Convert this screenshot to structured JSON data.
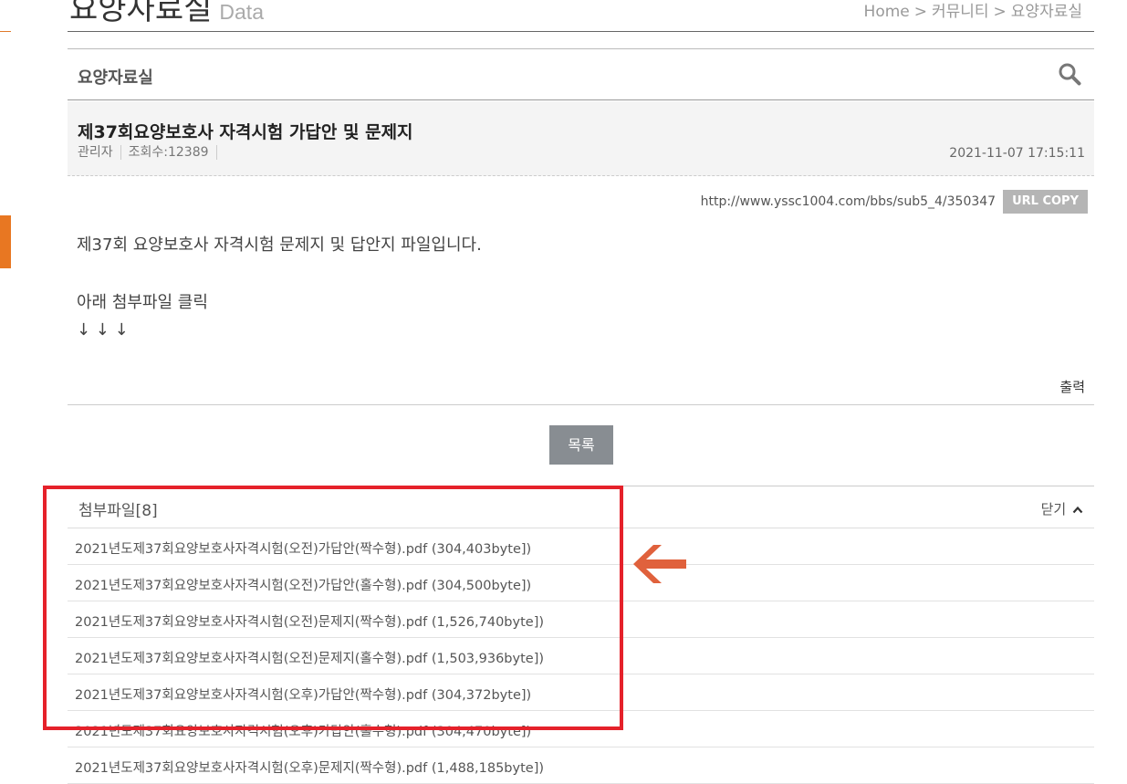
{
  "page": {
    "title_ko": "요양자료실",
    "title_en": "Data",
    "breadcrumb": [
      "Home",
      "커뮤니티",
      "요양자료실"
    ],
    "breadcrumb_sep": ">"
  },
  "board": {
    "name": "요양자료실",
    "search_icon": "search-icon"
  },
  "post": {
    "title": "제37회요양보호사 자격시험 가답안 및 문제지",
    "author": "관리자",
    "views": "조회수:12389",
    "date": "2021-11-07 17:15:11",
    "url": "http://www.yssc1004.com/bbs/sub5_4/350347",
    "url_copy_label": "URL COPY",
    "body": [
      "제37회 요양보호사 자격시험 문제지 및 답안지 파일입니다.",
      "아래 첨부파일 클릭",
      "↓ ↓ ↓"
    ],
    "print_label": "출력"
  },
  "list_button": "목록",
  "attachments": {
    "label": "첨부파일[8]",
    "close_label": "닫기",
    "items": [
      "2021년도제37회요양보호사자격시험(오전)가답안(짝수형).pdf (304,403byte])",
      "2021년도제37회요양보호사자격시험(오전)가답안(홀수형).pdf (304,500byte])",
      "2021년도제37회요양보호사자격시험(오전)문제지(짝수형).pdf (1,526,740byte])",
      "2021년도제37회요양보호사자격시험(오전)문제지(홀수형).pdf (1,503,936byte])",
      "2021년도제37회요양보호사자격시험(오후)가답안(짝수형).pdf (304,372byte])",
      "2021년도제37회요양보호사자격시험(오후)가답안(홀수형).pdf (304,470byte])",
      "2021년도제37회요양보호사자격시험(오후)문제지(짝수형).pdf (1,488,185byte])"
    ]
  },
  "colors": {
    "accent": "#e87722",
    "highlight": "#e5212a",
    "arrow": "#e0613c"
  }
}
